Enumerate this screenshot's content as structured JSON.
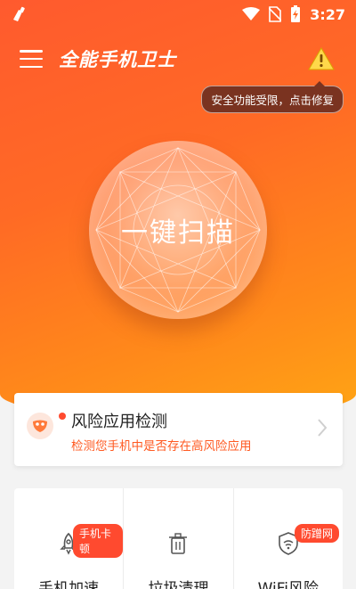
{
  "status_bar": {
    "time": "3:27"
  },
  "header": {
    "title": "全能手机卫士",
    "warning_tooltip": "安全功能受限，点击修复"
  },
  "scan": {
    "label": "一键扫描"
  },
  "risk_card": {
    "title": "风险应用检测",
    "description": "检测您手机中是否存在高风险应用"
  },
  "tools": [
    {
      "label": "手机加速",
      "badge": "手机卡顿"
    },
    {
      "label": "垃圾清理",
      "badge": ""
    },
    {
      "label": "WiFi风险",
      "badge": "防蹭网"
    }
  ],
  "colors": {
    "accent": "#ff5a2e",
    "badge": "#ff4a2f",
    "risk_text": "#ff5a22"
  }
}
